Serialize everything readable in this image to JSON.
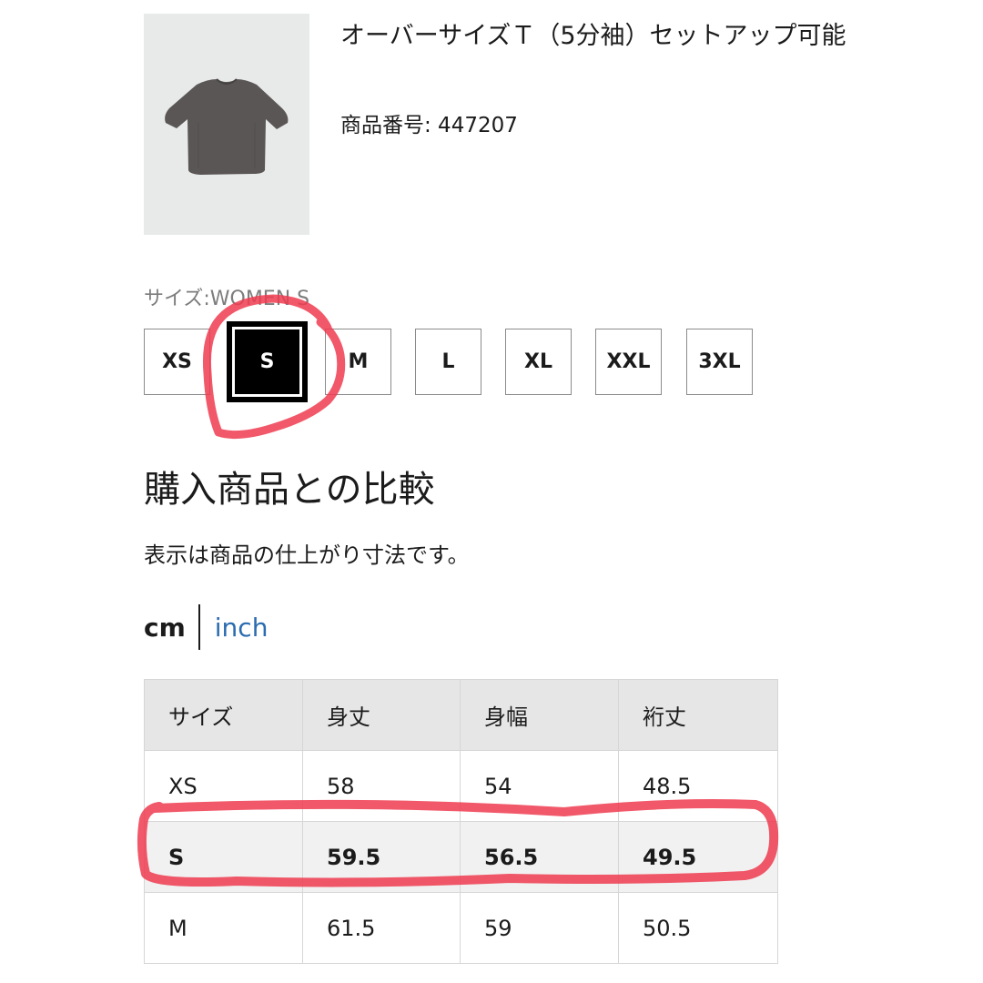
{
  "product": {
    "name": "オーバーサイズＴ（5分袖）セットアップ可能",
    "id_text": "商品番号: 447207"
  },
  "size_selector": {
    "label": "サイズ:WOMEN S",
    "options": [
      "XS",
      "S",
      "M",
      "L",
      "XL",
      "XXL",
      "3XL"
    ],
    "selected": "S"
  },
  "comparison": {
    "title": "購入商品との比較",
    "note": "表示は商品の仕上がり寸法です。"
  },
  "units": {
    "cm_label": "cm",
    "inch_label": "inch",
    "active": "cm"
  },
  "size_table": {
    "headers": [
      "サイズ",
      "身丈",
      "身幅",
      "裄丈"
    ],
    "rows": [
      [
        "XS",
        "58",
        "54",
        "48.5"
      ],
      [
        "S",
        "59.5",
        "56.5",
        "49.5"
      ],
      [
        "M",
        "61.5",
        "59",
        "50.5"
      ]
    ],
    "highlighted_row": "S"
  },
  "colors": {
    "annotation": "#ee3b4f",
    "unit_link": "#2b6cb0",
    "shirt": "#5a5655"
  }
}
